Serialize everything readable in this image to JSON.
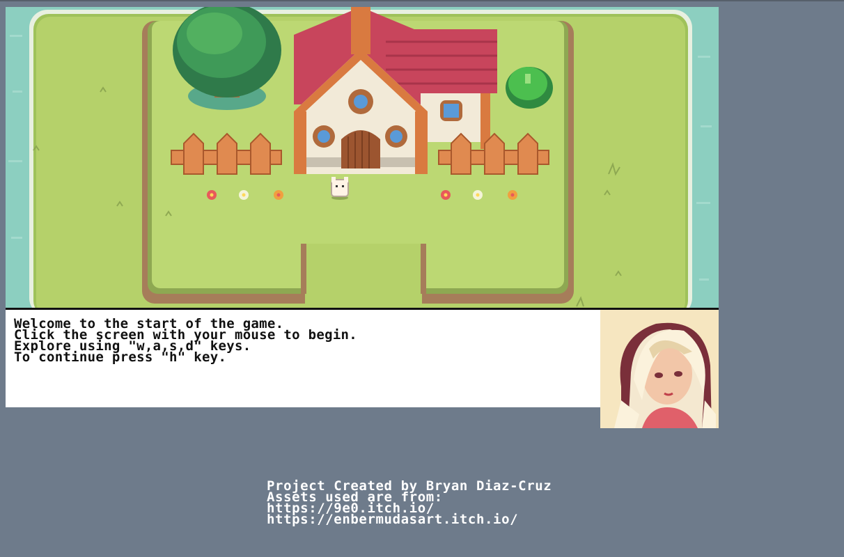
{
  "dialog": {
    "lines": [
      "Welcome to the start of the game.",
      "Click the screen with your mouse to begin.",
      "Explore using \"w,a,s,d\" keys.",
      "To continue press \"h\" key."
    ]
  },
  "credits": {
    "line1": "Project Created by Bryan Diaz-Cruz",
    "line2": "Assets used are from:",
    "link1": "https://9e0.itch.io/",
    "link2": "https://enbermudasart.itch.io/"
  },
  "colors": {
    "page_background": "#6e7b8b",
    "grass": "#b5d16a",
    "water": "#8ccfc0",
    "roof": "#c8455c",
    "dialog_background": "#ffffff",
    "dialog_text": "#101010",
    "credits_text": "#ffffff"
  }
}
